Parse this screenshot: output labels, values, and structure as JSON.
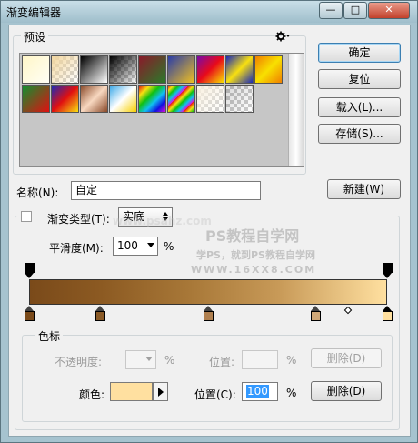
{
  "window": {
    "title": "渐变编辑器",
    "controls": {
      "minimize": "—",
      "maximize": "□",
      "close": "✕"
    }
  },
  "presets": {
    "label": "预设",
    "gear_icon": "gear-icon",
    "swatches": [
      {
        "css": "linear-gradient(135deg,#fff6c8,#fffef5)"
      },
      {
        "css": "linear-gradient(135deg,#f2d7a1,rgba(255,255,255,0))",
        "checker": true
      },
      {
        "css": "linear-gradient(135deg,#000,#fff)"
      },
      {
        "css": "linear-gradient(135deg,#000,rgba(255,255,255,0))",
        "checker": true
      },
      {
        "css": "linear-gradient(135deg,#8a1a2a,#2a7a2a)"
      },
      {
        "css": "linear-gradient(135deg,#2a3da8,#f0c020)"
      },
      {
        "css": "linear-gradient(135deg,#7a0aa8,#e80a1a,#f8e000)"
      },
      {
        "css": "linear-gradient(135deg,#1a2ab8,#f8e010,#1a2ab8)"
      },
      {
        "css": "linear-gradient(135deg,#f08000,#f8e000,#f08000)"
      },
      {
        "css": "linear-gradient(135deg,#109030,#e01010)"
      },
      {
        "css": "linear-gradient(135deg,#1a2ab8,#e01010,#f8e010)"
      },
      {
        "css": "linear-gradient(135deg,#8a4a2a,#f8d8c0,#8a4a2a)"
      },
      {
        "css": "linear-gradient(135deg,#3aa8e8,#fff,#f8d000)"
      },
      {
        "css": "linear-gradient(135deg,#e01010,#f8e010,#10c010,#10c0f0,#1010e0,#e010e0)"
      },
      {
        "css": "repeating-linear-gradient(135deg,#e01010 0,#f8e010 4px,#10c010 8px,#10c0f0 12px,#e010e0 16px)"
      },
      {
        "css": "linear-gradient(135deg,#f8f0e0,rgba(255,255,255,0))",
        "checker": true
      },
      {
        "css": "linear-gradient(135deg,rgba(0,0,0,0.15),rgba(255,255,255,0))",
        "checker": true
      }
    ]
  },
  "buttons": {
    "ok": "确定",
    "reset": "复位",
    "load": "载入(L)...",
    "save": "存储(S)...",
    "new": "新建(W)",
    "delete_opacity": "删除(D)",
    "delete_color": "删除(D)"
  },
  "name_field": {
    "label": "名称(N):",
    "value": "自定"
  },
  "gradient_type": {
    "label": "渐变类型(T):",
    "value": "实底"
  },
  "smoothness": {
    "label": "平滑度(M):",
    "value": "100",
    "unit": "%"
  },
  "gradient": {
    "css": "linear-gradient(90deg,#7a4a1a 0%,#8c5a22 20%,#a87838 45%,#c89a58 70%,#ffe0a0 100%)",
    "opacity_stops": [
      0,
      100
    ],
    "color_stops": [
      {
        "pos": 0,
        "color": "#7a4a1a"
      },
      {
        "pos": 20,
        "color": "#8a5a26"
      },
      {
        "pos": 50,
        "color": "#b08050"
      },
      {
        "pos": 80,
        "color": "#d0a878"
      },
      {
        "pos": 100,
        "color": "#ffe0a0"
      }
    ],
    "midpoint": 89
  },
  "color_stops_group": {
    "label": "色标",
    "opacity_label": "不透明度:",
    "opacity_unit": "%",
    "opacity_position_label": "位置:",
    "opacity_position_unit": "%",
    "color_label": "颜色:",
    "color_value": "#ffe0a0",
    "position_label": "位置(C):",
    "position_value": "100",
    "position_unit": "%"
  },
  "watermark": {
    "line1": "PS教程自学网",
    "line2": "学PS，就到PS教程自学网",
    "line3": "WWW.16XX8.COM",
    "faint": "www.psahz.com"
  }
}
